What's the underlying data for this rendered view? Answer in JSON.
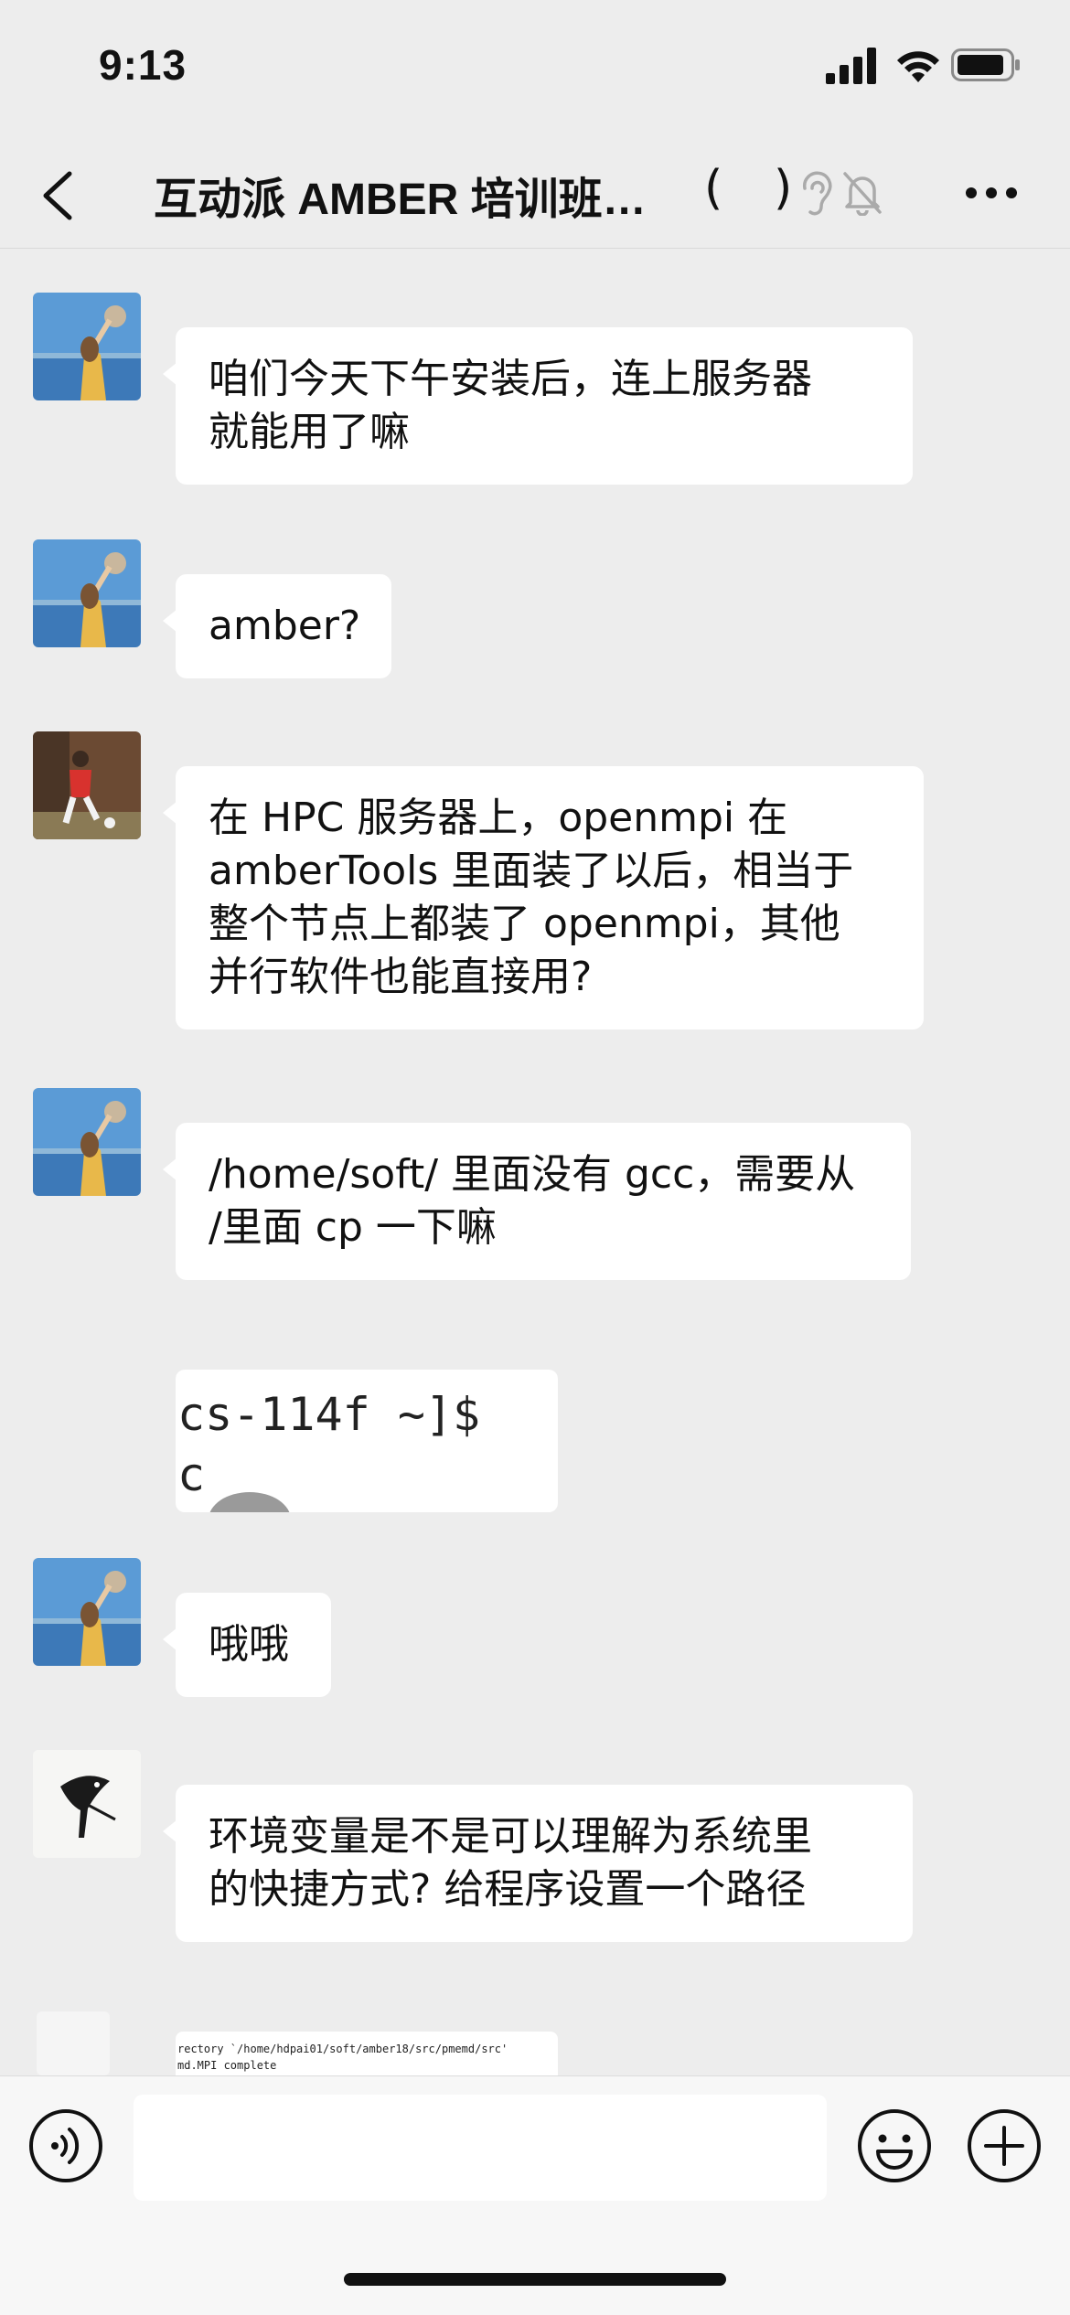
{
  "status_bar": {
    "time": "9:13"
  },
  "header": {
    "title": "互动派 AMBER 培训班…",
    "paren_open": "(",
    "paren_close": ")"
  },
  "messages": [
    {
      "type": "text",
      "avatar": "avatar-beach-girl",
      "lines": [
        "咱们今天下午安装后，连上服务器",
        "就能用了嘛"
      ]
    },
    {
      "type": "text",
      "avatar": "avatar-beach-girl",
      "lines": [
        "amber?"
      ]
    },
    {
      "type": "text",
      "avatar": "avatar-soccer-player",
      "lines": [
        "在 HPC 服务器上，openmpi 在",
        "amberTools 里面装了以后，相当于",
        "整个节点上都装了 openmpi，其他",
        "并行软件也能直接用?"
      ]
    },
    {
      "type": "text",
      "avatar": "avatar-beach-girl",
      "lines": [
        "/home/soft/ 里面没有 gcc，需要从",
        "/里面 cp 一下嘛"
      ]
    },
    {
      "type": "image",
      "terminal_lines": [
        "cs-114f ~]$",
        "c"
      ]
    },
    {
      "type": "text",
      "avatar": "avatar-beach-girl",
      "lines": [
        "哦哦"
      ]
    },
    {
      "type": "text",
      "avatar": "avatar-bird-ink",
      "lines": [
        "环境变量是不是可以理解为系统里",
        "的快捷方式? 给程序设置一个路径"
      ]
    },
    {
      "type": "image",
      "terminal_lines": [
        "rectory `/home/hdpai01/soft/amber18/src/pmemd/src'",
        "md.MPI complete"
      ]
    }
  ],
  "input_bar": {
    "placeholder": ""
  },
  "icons": [
    "back-chevron-icon",
    "ear-icon",
    "mute-bell-icon",
    "more-icon",
    "voice-icon",
    "emoji-icon",
    "plus-icon",
    "signal-icon",
    "wifi-icon",
    "battery-icon"
  ],
  "colors": {
    "background": "#ededed",
    "bubble": "#ffffff",
    "input_bar": "#f7f7f7"
  }
}
